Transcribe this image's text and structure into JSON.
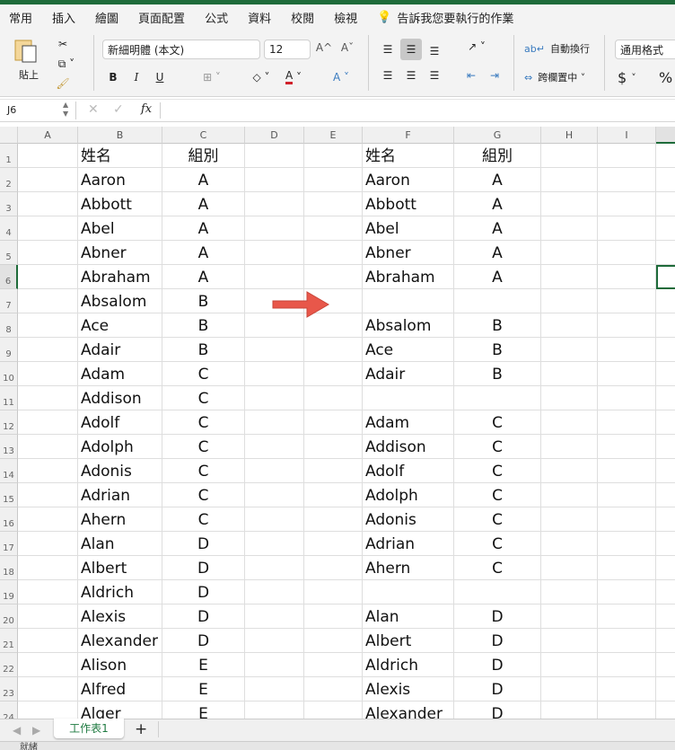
{
  "tabs": [
    "常用",
    "插入",
    "繪圖",
    "頁面配置",
    "公式",
    "資料",
    "校閱",
    "檢視"
  ],
  "tell_me": "告訴我您要執行的作業",
  "ribbon": {
    "paste": "貼上",
    "font_name": "新細明體 (本文)",
    "font_size": "12",
    "bold": "B",
    "italic": "I",
    "underline": "U",
    "wrap_text": "自動換行",
    "merge_center": "跨欄置中",
    "number_format": "通用格式",
    "currency": "$",
    "percent": "%",
    "grow": "A^",
    "shrink": "Aˇ",
    "font_color": "A"
  },
  "formula_bar": {
    "name_box": "J6",
    "fx": "fx",
    "value": ""
  },
  "columns": [
    "A",
    "B",
    "C",
    "D",
    "E",
    "F",
    "G",
    "H",
    "I"
  ],
  "rows": [
    "1",
    "2",
    "3",
    "4",
    "5",
    "6",
    "7",
    "8",
    "9",
    "10",
    "11",
    "12",
    "13",
    "14",
    "15",
    "16",
    "17",
    "18",
    "19",
    "20",
    "21",
    "22",
    "23",
    "24"
  ],
  "selected_cell": "J6",
  "left_table": {
    "headers": [
      "姓名",
      "組別"
    ],
    "rows": [
      [
        "Aaron",
        "A"
      ],
      [
        "Abbott",
        "A"
      ],
      [
        "Abel",
        "A"
      ],
      [
        "Abner",
        "A"
      ],
      [
        "Abraham",
        "A"
      ],
      [
        "Absalom",
        "B"
      ],
      [
        "Ace",
        "B"
      ],
      [
        "Adair",
        "B"
      ],
      [
        "Adam",
        "C"
      ],
      [
        "Addison",
        "C"
      ],
      [
        "Adolf",
        "C"
      ],
      [
        "Adolph",
        "C"
      ],
      [
        "Adonis",
        "C"
      ],
      [
        "Adrian",
        "C"
      ],
      [
        "Ahern",
        "C"
      ],
      [
        "Alan",
        "D"
      ],
      [
        "Albert",
        "D"
      ],
      [
        "Aldrich",
        "D"
      ],
      [
        "Alexis",
        "D"
      ],
      [
        "Alexander",
        "D"
      ],
      [
        "Alison",
        "E"
      ],
      [
        "Alfred",
        "E"
      ],
      [
        "Alger",
        "E"
      ]
    ]
  },
  "right_table": {
    "headers": [
      "姓名",
      "組別"
    ],
    "rows": [
      [
        "Aaron",
        "A"
      ],
      [
        "Abbott",
        "A"
      ],
      [
        "Abel",
        "A"
      ],
      [
        "Abner",
        "A"
      ],
      [
        "Abraham",
        "A"
      ],
      [
        "",
        ""
      ],
      [
        "Absalom",
        "B"
      ],
      [
        "Ace",
        "B"
      ],
      [
        "Adair",
        "B"
      ],
      [
        "",
        ""
      ],
      [
        "Adam",
        "C"
      ],
      [
        "Addison",
        "C"
      ],
      [
        "Adolf",
        "C"
      ],
      [
        "Adolph",
        "C"
      ],
      [
        "Adonis",
        "C"
      ],
      [
        "Adrian",
        "C"
      ],
      [
        "Ahern",
        "C"
      ],
      [
        "",
        ""
      ],
      [
        "Alan",
        "D"
      ],
      [
        "Albert",
        "D"
      ],
      [
        "Aldrich",
        "D"
      ],
      [
        "Alexis",
        "D"
      ],
      [
        "Alexander",
        "D"
      ]
    ]
  },
  "arrow_color": "#e8574a",
  "sheet_tab": "工作表1",
  "add_sheet": "+",
  "status": "就緒"
}
